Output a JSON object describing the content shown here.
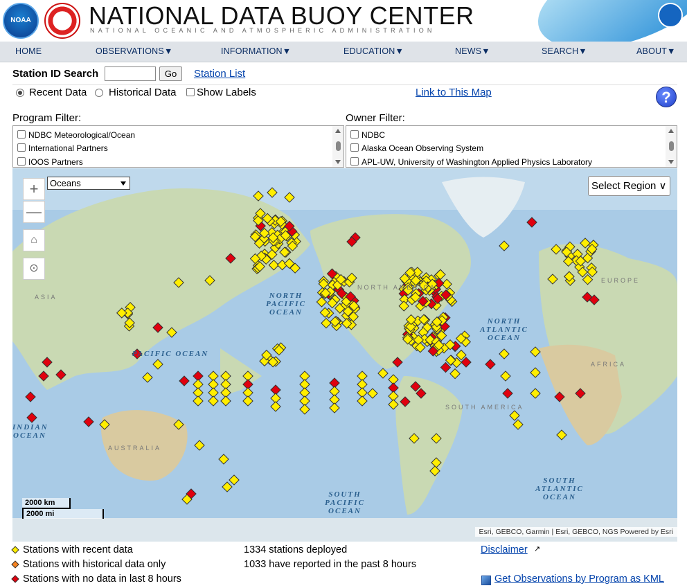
{
  "header": {
    "title": "NATIONAL DATA BUOY CENTER",
    "subtitle": "NATIONAL OCEANIC AND ATMOSPHERIC ADMINISTRATION",
    "noaa_logo": "NOAA"
  },
  "nav": {
    "items": [
      {
        "label": "HOME"
      },
      {
        "label": "OBSERVATIONS▼"
      },
      {
        "label": "INFORMATION▼"
      },
      {
        "label": "EDUCATION▼"
      },
      {
        "label": "NEWS▼"
      },
      {
        "label": "SEARCH▼"
      },
      {
        "label": "ABOUT▼"
      }
    ]
  },
  "search": {
    "label": "Station ID Search",
    "value": "",
    "go_label": "Go",
    "station_list_link": "Station List"
  },
  "options": {
    "recent_label": "Recent Data",
    "historical_label": "Historical Data",
    "show_labels_label": "Show Labels",
    "selected": "Recent Data",
    "link_to_map": "Link to This Map",
    "help_label": "?"
  },
  "program_filter": {
    "label": "Program Filter:",
    "items": [
      "NDBC Meteorological/Ocean",
      "International Partners",
      "IOOS Partners"
    ]
  },
  "owner_filter": {
    "label": "Owner Filter:",
    "items": [
      "NDBC",
      "Alaska Ocean Observing System",
      "APL-UW, University of Washington Applied Physics Laboratory"
    ]
  },
  "map": {
    "basemap_select": "Oceans",
    "region_button": "Select Region ∨",
    "zoom_in": "+",
    "zoom_out": "—",
    "scale_km": "2000 km",
    "scale_mi": "2000 mi",
    "attribution": "Esri, GEBCO, Garmin | Esri, GEBCO, NGS  Powered by Esri",
    "ocean_labels": {
      "north_pacific": "NORTH PACIFIC OCEAN",
      "pacific": "PACIFIC OCEAN",
      "north_atlantic": "NORTH ATLANTIC OCEAN",
      "south_pacific": "SOUTH PACIFIC OCEAN",
      "south_atlantic": "SOUTH ATLANTIC OCEAN",
      "indian": "INDIAN OCEAN"
    },
    "land_labels": {
      "asia": "ASIA",
      "north_america": "NORTH AMERICA",
      "europe": "EUROPE",
      "africa": "AFRICA",
      "south_america": "SOUTH AMERICA",
      "australia": "AUSTRALIA"
    },
    "colors": {
      "recent": "#ffee00",
      "historical": "#f58220",
      "no_data": "#e0000e"
    }
  },
  "legend": {
    "recent": "Stations with recent data",
    "historical": "Stations with historical data only",
    "no_data": "Stations with no data in last 8 hours",
    "deployed": "1334 stations deployed",
    "reported": "1033 have reported in the past 8 hours",
    "disclaimer": "Disclaimer",
    "kml_link": "Get Observations by Program as KML"
  }
}
